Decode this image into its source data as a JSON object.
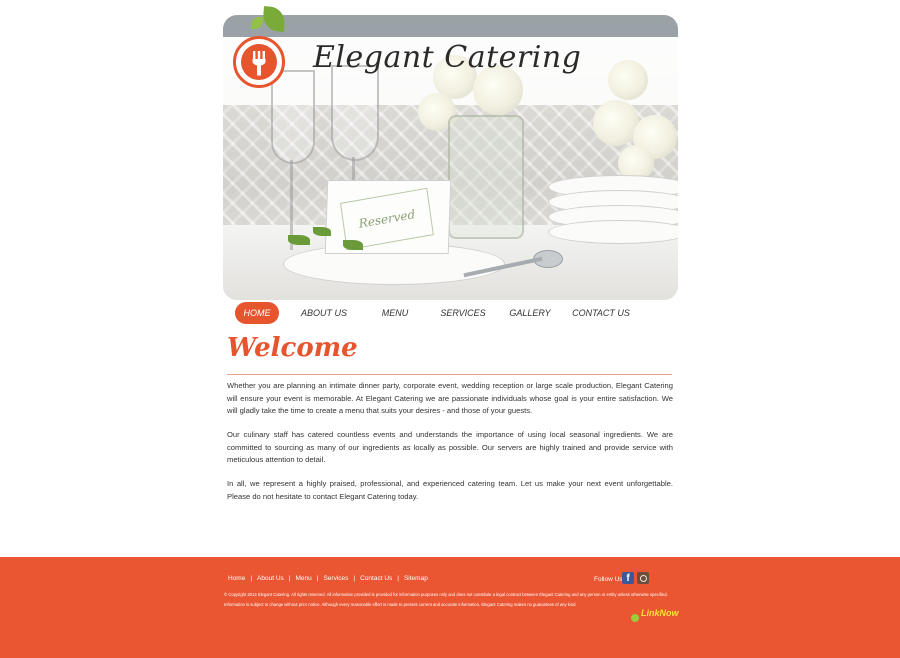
{
  "header": {
    "brand": "Elegant Catering",
    "card_text": "Reserved"
  },
  "nav": {
    "items": [
      {
        "label": "HOME",
        "active": true
      },
      {
        "label": "ABOUT US",
        "active": false
      },
      {
        "label": "MENU",
        "active": false
      },
      {
        "label": "SERVICES",
        "active": false
      },
      {
        "label": "GALLERY",
        "active": false
      },
      {
        "label": "CONTACT US",
        "active": false
      }
    ]
  },
  "main": {
    "heading": "Welcome",
    "paragraphs": [
      "Whether you are planning an intimate dinner party, corporate event, wedding reception or large scale production, Elegant Catering will ensure your event is memorable. At Elegant Catering we are passionate individuals whose goal is your entire satisfaction. We will gladly take the time to create a menu that suits your desires - and those of your guests.",
      "Our culinary staff has catered countless events and understands the importance of using local seasonal ingredients. We are committed to sourcing as many of our ingredients as locally as possible. Our servers are highly trained and provide service with meticulous attention to detail.",
      "In all, we represent a highly praised, professional, and experienced catering team. Let us make your next event unforgettable. Please do not hesitate to contact Elegant Catering today."
    ]
  },
  "footer": {
    "links": [
      "Home",
      "About Us",
      "Menu",
      "Services",
      "Contact Us",
      "Sitemap"
    ],
    "separator": "|",
    "follow_label": "Follow Us",
    "facebook_glyph": "f",
    "copyright": "© Copyright 2014 Elegant Catering. All rights reserved. All information provided is provided for information purposes only and does not constitute a legal contract between Elegant Catering and any person or entity unless otherwise specified. Information is subject to change without prior notice. Although every reasonable effort is made to present current and accurate information, Elegant Catering makes no guarantees of any kind.",
    "partner_logo_text": "LinkNow"
  },
  "colors": {
    "accent": "#e7552f",
    "footer_bg": "#ea5532",
    "leaf_green": "#7aab39"
  }
}
